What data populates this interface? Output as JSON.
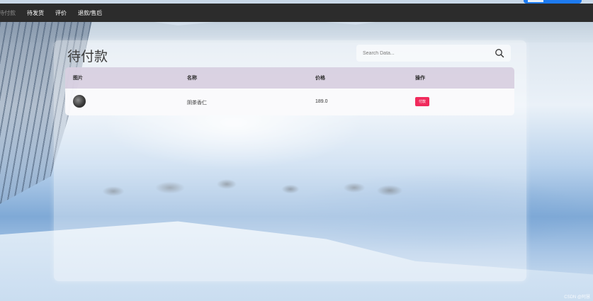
{
  "nav": {
    "items": [
      {
        "label": "待付款",
        "active": true
      },
      {
        "label": "待发货",
        "active": false
      },
      {
        "label": "评价",
        "active": false
      },
      {
        "label": "退款/售后",
        "active": false
      }
    ]
  },
  "panel": {
    "title": "待付款",
    "search": {
      "placeholder": "Search Data...",
      "value": ""
    }
  },
  "table": {
    "headers": [
      "图片",
      "名称",
      "价格",
      "操作"
    ],
    "rows": [
      {
        "name": "阴茶香仁",
        "price": "189.0",
        "action": "付款"
      }
    ]
  },
  "watermark": "CSDN @阿慧",
  "colors": {
    "topbar": "#2c2c2c",
    "header_row": "#d8d0e0",
    "action_button": "#f02a5c"
  }
}
